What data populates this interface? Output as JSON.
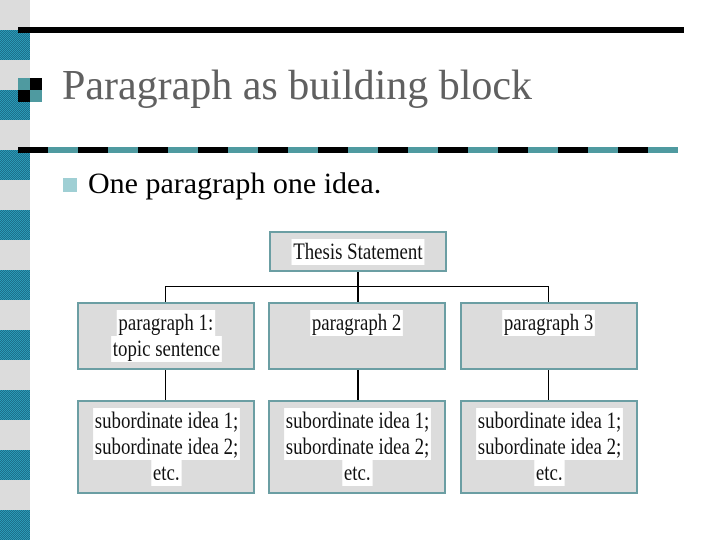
{
  "slide": {
    "title": "Paragraph as building block",
    "bullets": [
      {
        "text": "One paragraph one idea."
      }
    ]
  },
  "theme": {
    "accent": "#4f9aa0",
    "strip_teal": "#2a9ab8",
    "strip_gray": "#dcdcdc",
    "box_fill": "#dcdcdc",
    "box_border": "#6b9ea3",
    "title_color": "#606060"
  },
  "diagram": {
    "root": {
      "lines": [
        "Thesis Statement"
      ]
    },
    "paragraphs": [
      {
        "lines": [
          "paragraph 1:",
          "topic sentence"
        ],
        "details": [
          "subordinate idea 1;",
          "subordinate idea 2;",
          "etc."
        ]
      },
      {
        "lines": [
          "paragraph 2"
        ],
        "details": [
          "subordinate idea 1;",
          "subordinate idea 2;",
          "etc."
        ]
      },
      {
        "lines": [
          "paragraph 3"
        ],
        "details": [
          "subordinate idea 1;",
          "subordinate idea 2;",
          "etc."
        ]
      }
    ]
  }
}
